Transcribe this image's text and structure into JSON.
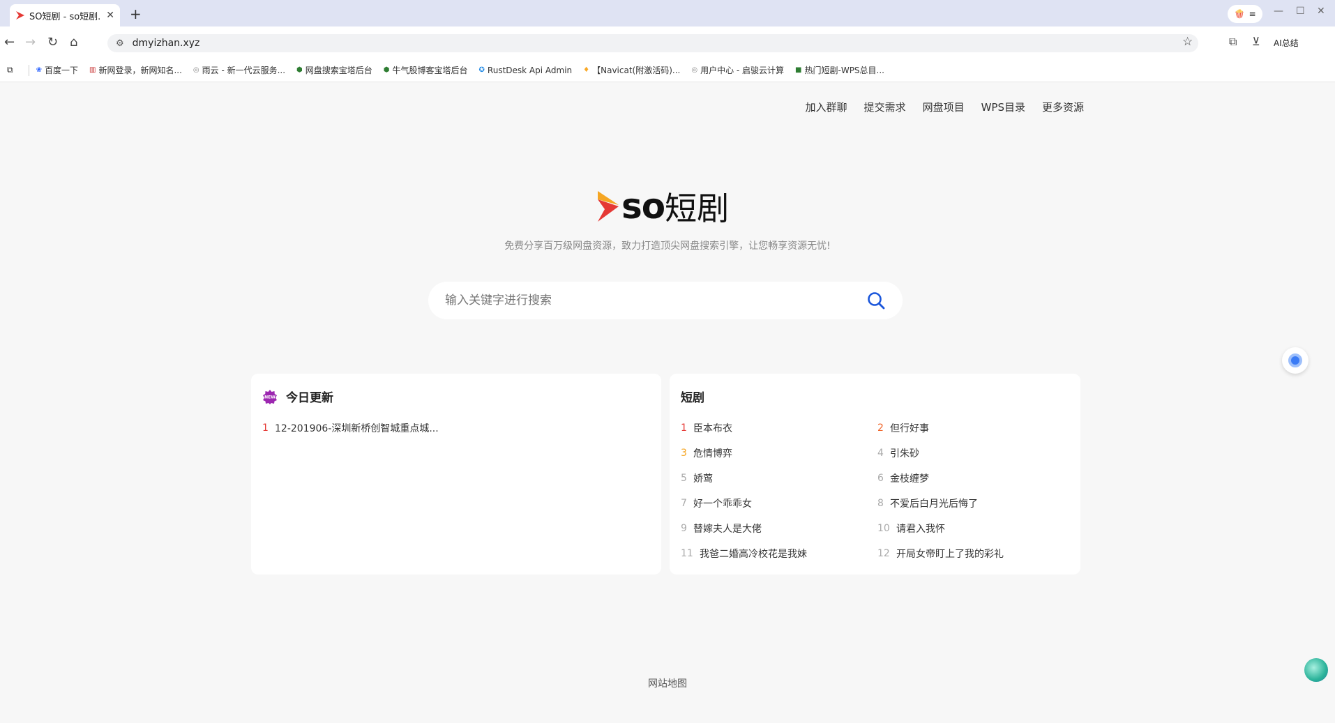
{
  "browser": {
    "tab_title": "SO短剧 - so短剧.",
    "new_tab": "+",
    "url": "dmyizhan.xyz",
    "ai_summary": "AI总结",
    "bookmarks": [
      {
        "label": "百度一下",
        "icon": "paw-icon"
      },
      {
        "label": "新网登录，新网知名...",
        "icon": "site-icon"
      },
      {
        "label": "雨云 - 新一代云服务...",
        "icon": "cloud-icon"
      },
      {
        "label": "网盘搜索宝塔后台",
        "icon": "shield-icon"
      },
      {
        "label": "牛气股博客宝塔后台",
        "icon": "shield-icon"
      },
      {
        "label": "RustDesk Api Admin",
        "icon": "rustdesk-icon"
      },
      {
        "label": "【Navicat(附激活码)...",
        "icon": "bolt-icon"
      },
      {
        "label": "用户中心 - 启骏云计算",
        "icon": "cloud-icon"
      },
      {
        "label": "热门短剧-WPS总目...",
        "icon": "doc-icon"
      }
    ]
  },
  "topnav": [
    "加入群聊",
    "提交需求",
    "网盘项目",
    "WPS目录",
    "更多资源"
  ],
  "logo": {
    "brand": "SO",
    "brand_cn": "短剧"
  },
  "tagline": "免费分享百万级网盘资源，致力打造顶尖网盘搜索引擎，让您畅享资源无忧!",
  "search": {
    "placeholder": "输入关键字进行搜索"
  },
  "today": {
    "title": "今日更新",
    "items": [
      {
        "num": "1",
        "text": "12-201906-深圳新桥创智城重点城..."
      }
    ]
  },
  "dramas": {
    "title": "短剧",
    "items": [
      {
        "num": "1",
        "text": "臣本布衣"
      },
      {
        "num": "2",
        "text": "但行好事"
      },
      {
        "num": "3",
        "text": "危情博弈"
      },
      {
        "num": "4",
        "text": "引朱砂"
      },
      {
        "num": "5",
        "text": "娇莺"
      },
      {
        "num": "6",
        "text": "金枝缠梦"
      },
      {
        "num": "7",
        "text": "好一个乖乖女"
      },
      {
        "num": "8",
        "text": "不爱后白月光后悔了"
      },
      {
        "num": "9",
        "text": "替嫁夫人是大佬"
      },
      {
        "num": "10",
        "text": "请君入我怀"
      },
      {
        "num": "11",
        "text": "我爸二婚高冷校花是我妹"
      },
      {
        "num": "12",
        "text": "开局女帝盯上了我的彩礼"
      }
    ]
  },
  "footer": "网站地图",
  "colors": {
    "accent": "#1a56db",
    "rank1": "#e53935",
    "rank2": "#f06529",
    "rank3": "#f5a623"
  }
}
